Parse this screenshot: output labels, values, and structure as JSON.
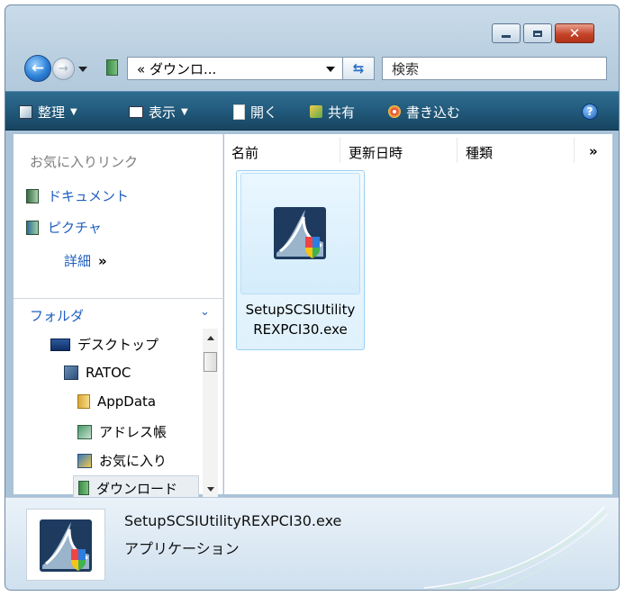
{
  "titlebar": {
    "buttons": [
      "minimize",
      "maximize",
      "close"
    ]
  },
  "nav": {
    "address_text": "« ダウンロ...",
    "search_placeholder": "検索"
  },
  "toolbar": {
    "organize": "整理",
    "views": "表示",
    "open": "開く",
    "share": "共有",
    "burn": "書き込む"
  },
  "favorites": {
    "title": "お気に入りリンク",
    "items": [
      "ドキュメント",
      "ピクチャ"
    ],
    "more": "詳細"
  },
  "folders": {
    "header": "フォルダ",
    "tree": [
      "デスクトップ",
      "RATOC",
      "AppData",
      "アドレス帳",
      "お気に入り",
      "ダウンロード"
    ]
  },
  "columns": [
    "名前",
    "更新日時",
    "種類"
  ],
  "files": [
    {
      "name": "SetupSCSIUtility REXPCI30.exe"
    }
  ],
  "details": {
    "filename": "SetupSCSIUtilityREXPCI30.exe",
    "filetype": "アプリケーション"
  },
  "colors": {
    "toolbar": "#235c7e",
    "link": "#1f5fc0",
    "selection": "#dff1fc"
  }
}
